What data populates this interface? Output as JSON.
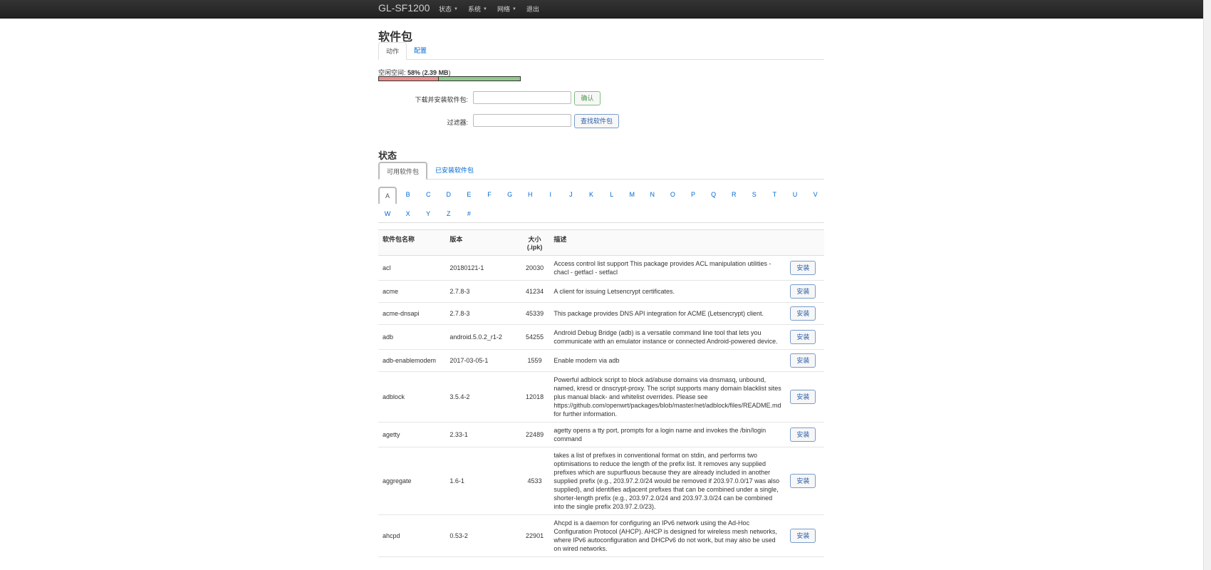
{
  "navbar": {
    "brand": "GL-SF1200",
    "items": [
      {
        "label": "状态",
        "has_caret": true
      },
      {
        "label": "系统",
        "has_caret": true
      },
      {
        "label": "网络",
        "has_caret": true
      },
      {
        "label": "退出",
        "has_caret": false
      }
    ]
  },
  "page": {
    "title": "软件包",
    "tabs": [
      {
        "label": "动作",
        "active": true
      },
      {
        "label": "配置",
        "active": false
      }
    ]
  },
  "free_space": {
    "label": "空闲空间:",
    "percent": "58%",
    "size": "2.39 MB",
    "used_fraction": 0.42
  },
  "form": {
    "download_label": "下载并安装软件包:",
    "download_value": "",
    "confirm_label": "确认",
    "filter_label": "过滤器:",
    "filter_value": "",
    "find_label": "查找软件包"
  },
  "status": {
    "title": "状态",
    "tabs": [
      {
        "label": "可用软件包",
        "active": true
      },
      {
        "label": "已安装软件包",
        "active": false
      }
    ]
  },
  "letters": [
    "A",
    "B",
    "C",
    "D",
    "E",
    "F",
    "G",
    "H",
    "I",
    "J",
    "K",
    "L",
    "M",
    "N",
    "O",
    "P",
    "Q",
    "R",
    "S",
    "T",
    "U",
    "V",
    "W",
    "X",
    "Y",
    "Z",
    "#"
  ],
  "active_letter": "A",
  "table": {
    "headers": {
      "name": "软件包名称",
      "version": "版本",
      "size_line1": "大小",
      "size_line2": "(.ipk)",
      "desc": "描述"
    },
    "install_label": "安装",
    "rows": [
      {
        "name": "acl",
        "version": "20180121-1",
        "size": "20030",
        "desc": "Access control list support This package provides ACL manipulation utilities - chacl - getfacl - setfacl"
      },
      {
        "name": "acme",
        "version": "2.7.8-3",
        "size": "41234",
        "desc": "A client for issuing Letsencrypt certificates."
      },
      {
        "name": "acme-dnsapi",
        "version": "2.7.8-3",
        "size": "45339",
        "desc": "This package provides DNS API integration for ACME (Letsencrypt) client."
      },
      {
        "name": "adb",
        "version": "android.5.0.2_r1-2",
        "size": "54255",
        "desc": "Android Debug Bridge (adb) is a versatile command line tool that lets you communicate with an emulator instance or connected Android-powered device."
      },
      {
        "name": "adb-enablemodem",
        "version": "2017-03-05-1",
        "size": "1559",
        "desc": "Enable modem via adb"
      },
      {
        "name": "adblock",
        "version": "3.5.4-2",
        "size": "12018",
        "desc": "Powerful adblock script to block ad/abuse domains via dnsmasq, unbound, named, kresd or dnscrypt-proxy. The script supports many domain blacklist sites plus manual black- and whitelist overrides. Please see https://github.com/openwrt/packages/blob/master/net/adblock/files/README.md for further information."
      },
      {
        "name": "agetty",
        "version": "2.33-1",
        "size": "22489",
        "desc": "agetty opens a tty port, prompts for a login name and invokes the /bin/login command"
      },
      {
        "name": "aggregate",
        "version": "1.6-1",
        "size": "4533",
        "desc": "takes a list of prefixes in conventional format on stdin, and performs two optimisations to reduce the length of the prefix list. It removes any supplied prefixes which are supurfluous because they are already included in another supplied prefix (e.g., 203.97.2.0/24 would be removed if 203.97.0.0/17 was also supplied), and identifies adjacent prefixes that can be combined under a single, shorter-length prefix (e.g., 203.97.2.0/24 and 203.97.3.0/24 can be combined into the single prefix 203.97.2.0/23)."
      },
      {
        "name": "ahcpd",
        "version": "0.53-2",
        "size": "22901",
        "desc": "Ahcpd is a daemon for configuring an IPv6 network using the Ad-Hoc Configuration Protocol (AHCP). AHCP is designed for wireless mesh networks, where IPv6 autoconfiguration and DHCPv6 do not work, but may also be used on wired networks."
      }
    ]
  }
}
